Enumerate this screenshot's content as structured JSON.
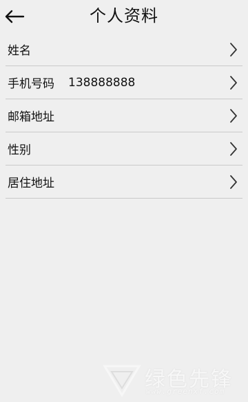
{
  "header": {
    "title": "个人资料",
    "back_icon": "arrow-left-icon"
  },
  "rows": [
    {
      "label": "姓名",
      "value": ""
    },
    {
      "label": "手机号码",
      "value": "138888888"
    },
    {
      "label": "邮箱地址",
      "value": ""
    },
    {
      "label": "性别",
      "value": ""
    },
    {
      "label": "居住地址",
      "value": ""
    }
  ],
  "watermark": {
    "text": "绿色先锋",
    "url": "www.greenxf.com"
  },
  "colors": {
    "background": "#efefef",
    "divider": "#c9c9c9",
    "text": "#111111"
  }
}
